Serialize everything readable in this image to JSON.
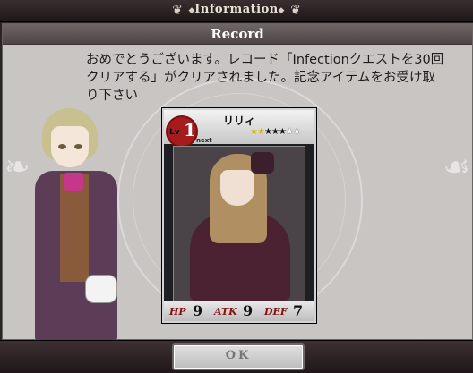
{
  "header": {
    "title": "Information"
  },
  "panel": {
    "title": "Record",
    "message": "おめでとうございます。レコード「Infectionクエストを30回クリアする」がクリアされました。記念アイテムをお受け取り下さい"
  },
  "card": {
    "name": "リリィ",
    "level_label": "Lv",
    "level": "1",
    "next_label": "next",
    "rarity_stars": {
      "gold": 2,
      "black": 3,
      "white": 2
    },
    "stats": {
      "hp_label": "HP",
      "hp": "9",
      "atk_label": "ATK",
      "atk": "9",
      "def_label": "DEF",
      "def": "7"
    }
  },
  "footer": {
    "ok_label": "OK"
  }
}
